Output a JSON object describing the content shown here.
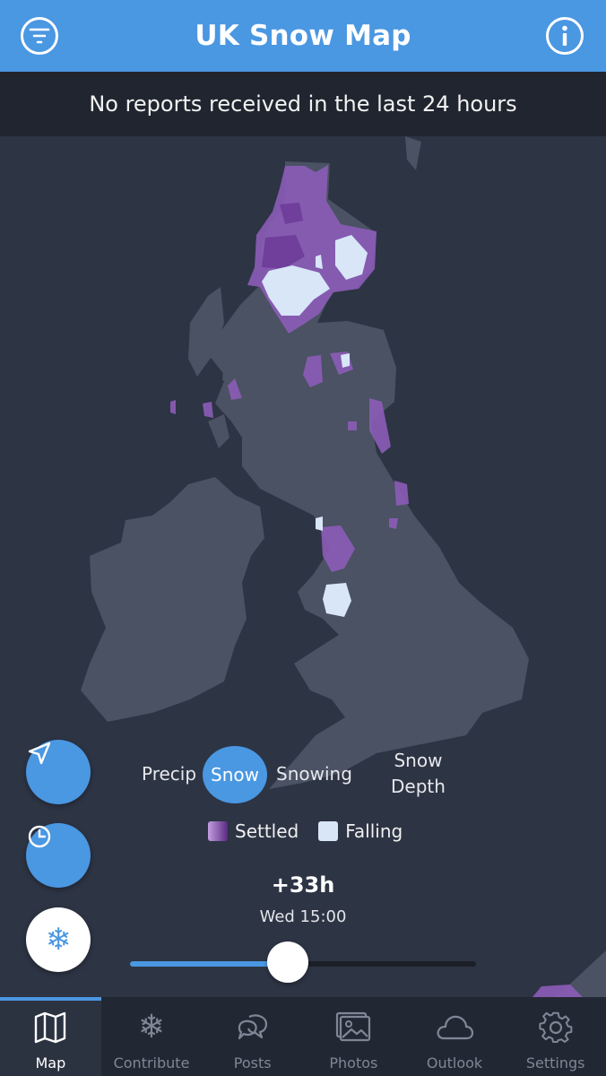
{
  "header": {
    "title": "UK Snow Map",
    "filter_icon": "filter-icon",
    "info_icon": "info-icon"
  },
  "banner": {
    "text": "No reports received in the last 24 hours"
  },
  "layers": {
    "precip": "Precip",
    "snow": "Snow",
    "snowing": "Snowing",
    "snow_depth_line1": "Snow",
    "snow_depth_line2": "Depth",
    "active": "Snow"
  },
  "legend": {
    "settled": "Settled",
    "falling": "Falling"
  },
  "time": {
    "offset": "+33h",
    "label": "Wed 15:00",
    "slider_fraction": 0.456
  },
  "fabs": {
    "locate": "location-arrow-icon",
    "history": "clock-icon",
    "snow": "snowflake-icon"
  },
  "tabs": [
    {
      "label": "Map",
      "icon": "map-icon",
      "active": true
    },
    {
      "label": "Contribute",
      "icon": "snowflake-icon",
      "active": false
    },
    {
      "label": "Posts",
      "icon": "chat-bubbles-icon",
      "active": false
    },
    {
      "label": "Photos",
      "icon": "photos-icon",
      "active": false
    },
    {
      "label": "Outlook",
      "icon": "cloud-icon",
      "active": false
    },
    {
      "label": "Settings",
      "icon": "gear-icon",
      "active": false
    }
  ],
  "colors": {
    "accent": "#4a97e2",
    "settled": "#8c5cb8",
    "falling": "#d8e6f8",
    "land": "#4a5263"
  }
}
